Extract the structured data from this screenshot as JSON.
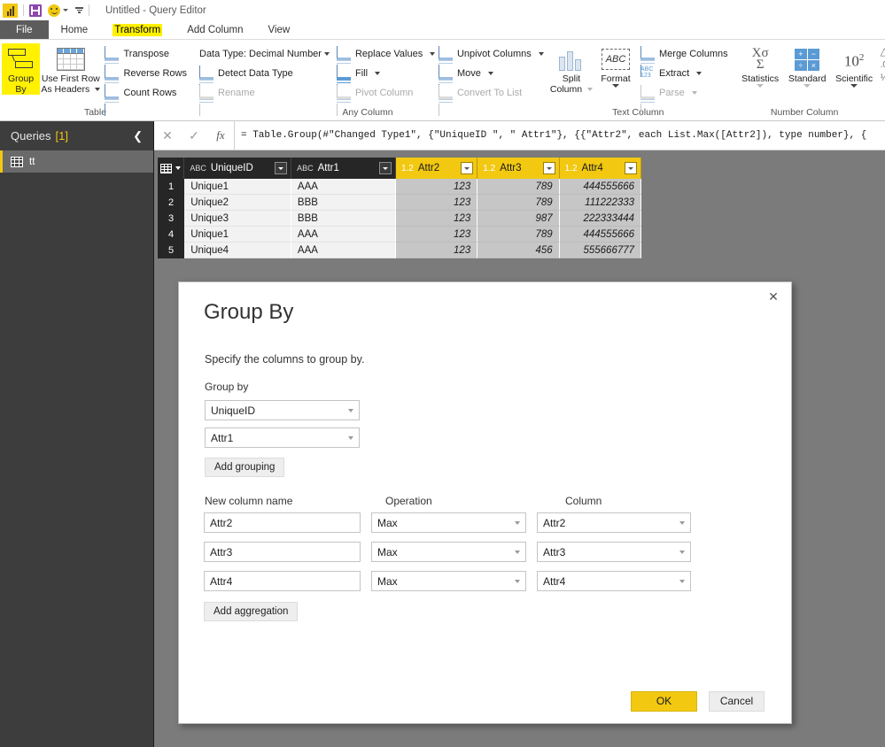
{
  "titlebar": {
    "app_title": "Untitled - Query Editor",
    "logo_name": "power-bi-logo",
    "save_label": "save-icon",
    "smiley_label": "smiley-icon"
  },
  "tabs": {
    "file": "File",
    "items": [
      {
        "label": "Home",
        "active": false,
        "highlighted": false
      },
      {
        "label": "Transform",
        "active": true,
        "highlighted": true
      },
      {
        "label": "Add Column",
        "active": false,
        "highlighted": false
      },
      {
        "label": "View",
        "active": false,
        "highlighted": false
      }
    ]
  },
  "ribbon": {
    "groups": [
      {
        "name": "Table",
        "label": "Table",
        "big_buttons": [
          {
            "label1": "Group",
            "label2": "By",
            "icon": "group-by-icon",
            "highlighted": true
          },
          {
            "label1": "Use First Row",
            "label2": "As Headers",
            "icon": "use-first-row-icon",
            "has_caret": true
          }
        ],
        "small_buttons": [
          {
            "label": "Transpose",
            "icon": "transpose-icon",
            "disabled": false
          },
          {
            "label": "Reverse Rows",
            "icon": "reverse-rows-icon",
            "disabled": false
          },
          {
            "label": "Count Rows",
            "icon": "count-rows-icon",
            "disabled": false
          }
        ]
      },
      {
        "name": "Any Column",
        "label": "Any Column",
        "rows": [
          {
            "label": "Data Type: Decimal Number",
            "icon": "data-type-icon",
            "caret": true,
            "disabled": false
          },
          {
            "label": "Detect Data Type",
            "icon": "detect-data-type-icon",
            "caret": false,
            "disabled": false
          },
          {
            "label": "Rename",
            "icon": "rename-icon",
            "caret": false,
            "disabled": true
          },
          {
            "label": "Replace Values",
            "icon": "replace-values-icon",
            "caret": true,
            "disabled": false
          },
          {
            "label": "Fill",
            "icon": "fill-icon",
            "caret": true,
            "disabled": false
          },
          {
            "label": "Pivot Column",
            "icon": "pivot-column-icon",
            "caret": false,
            "disabled": true
          },
          {
            "label": "Unpivot Columns",
            "icon": "unpivot-columns-icon",
            "caret": true,
            "disabled": false
          },
          {
            "label": "Move",
            "icon": "move-icon",
            "caret": true,
            "disabled": false
          },
          {
            "label": "Convert To List",
            "icon": "convert-to-list-icon",
            "caret": false,
            "disabled": true
          }
        ]
      },
      {
        "name": "Text Column",
        "label": "Text Column",
        "big_buttons": [
          {
            "label1": "Split",
            "label2": "Column",
            "icon": "split-column-icon",
            "caret_disabled": true
          },
          {
            "label1": "Format",
            "label2": "",
            "icon": "format-icon",
            "caret_disabled": false
          }
        ],
        "small_buttons": [
          {
            "label": "Merge Columns",
            "icon": "merge-columns-icon",
            "disabled": false
          },
          {
            "label": "Extract",
            "icon": "extract-icon",
            "caret": true,
            "disabled": false
          },
          {
            "label": "Parse",
            "icon": "parse-icon",
            "caret": true,
            "disabled": true
          }
        ]
      },
      {
        "name": "Number Column",
        "label": "Number Column",
        "big_buttons": [
          {
            "label1": "Statistics",
            "label2": "",
            "icon": "statistics-icon",
            "caret_disabled": true
          },
          {
            "label1": "Standard",
            "label2": "",
            "icon": "standard-icon",
            "caret_disabled": true
          },
          {
            "label1": "Scientific",
            "label2": "",
            "icon": "scientific-icon",
            "caret_disabled": false
          }
        ]
      }
    ]
  },
  "queries_pane": {
    "title": "Queries",
    "count": "[1]",
    "collapse_icon": "chevron-left-icon",
    "items": [
      {
        "label": "tt",
        "selected": true,
        "icon": "table-icon"
      }
    ]
  },
  "formula_bar": {
    "cancel_icon": "cancel-icon",
    "accept_icon": "checkmark-icon",
    "fx_label": "fx",
    "value": "= Table.Group(#\"Changed Type1\", {\"UniqueID \", \" Attr1\"}, {{\"Attr2\", each List.Max([Attr2]), type number}, {"
  },
  "data_grid": {
    "columns": [
      {
        "name": "UniqueID",
        "type_badge": "ABC",
        "kind": "text"
      },
      {
        "name": "Attr1",
        "type_badge": "ABC",
        "kind": "text"
      },
      {
        "name": "Attr2",
        "type_badge": "1.2",
        "kind": "number"
      },
      {
        "name": "Attr3",
        "type_badge": "1.2",
        "kind": "number"
      },
      {
        "name": "Attr4",
        "type_badge": "1.2",
        "kind": "number"
      }
    ],
    "rows": [
      {
        "n": "1",
        "cells": [
          "Unique1",
          "AAA",
          "123",
          "789",
          "444555666"
        ]
      },
      {
        "n": "2",
        "cells": [
          "Unique2",
          "BBB",
          "123",
          "789",
          "111222333"
        ]
      },
      {
        "n": "3",
        "cells": [
          "Unique3",
          "BBB",
          "123",
          "987",
          "222333444"
        ]
      },
      {
        "n": "4",
        "cells": [
          "Unique1",
          "AAA",
          "123",
          "789",
          "444555666"
        ]
      },
      {
        "n": "5",
        "cells": [
          "Unique4",
          "AAA",
          "123",
          "456",
          "555666777"
        ]
      }
    ]
  },
  "dialog": {
    "title": "Group By",
    "subtitle": "Specify the columns to group by.",
    "close_label": "✕",
    "group_by_label": "Group by",
    "group_by_selects": [
      {
        "value": "UniqueID"
      },
      {
        "value": "Attr1"
      }
    ],
    "add_grouping_label": "Add grouping",
    "agg_headers": {
      "new_column_name": "New column name",
      "operation": "Operation",
      "column": "Column"
    },
    "aggregations": [
      {
        "new_name": "Attr2",
        "operation": "Max",
        "column": "Attr2"
      },
      {
        "new_name": "Attr3",
        "operation": "Max",
        "column": "Attr3"
      },
      {
        "new_name": "Attr4",
        "operation": "Max",
        "column": "Attr4"
      }
    ],
    "add_aggregation_label": "Add aggregation",
    "ok_label": "OK",
    "cancel_label": "Cancel"
  },
  "colors": {
    "accent_yellow": "#f2c811",
    "highlight_yellow": "#fff100",
    "header_dark": "#262626",
    "pane_dark": "#3d3d3d",
    "backdrop_gray": "#7b7b7b"
  }
}
